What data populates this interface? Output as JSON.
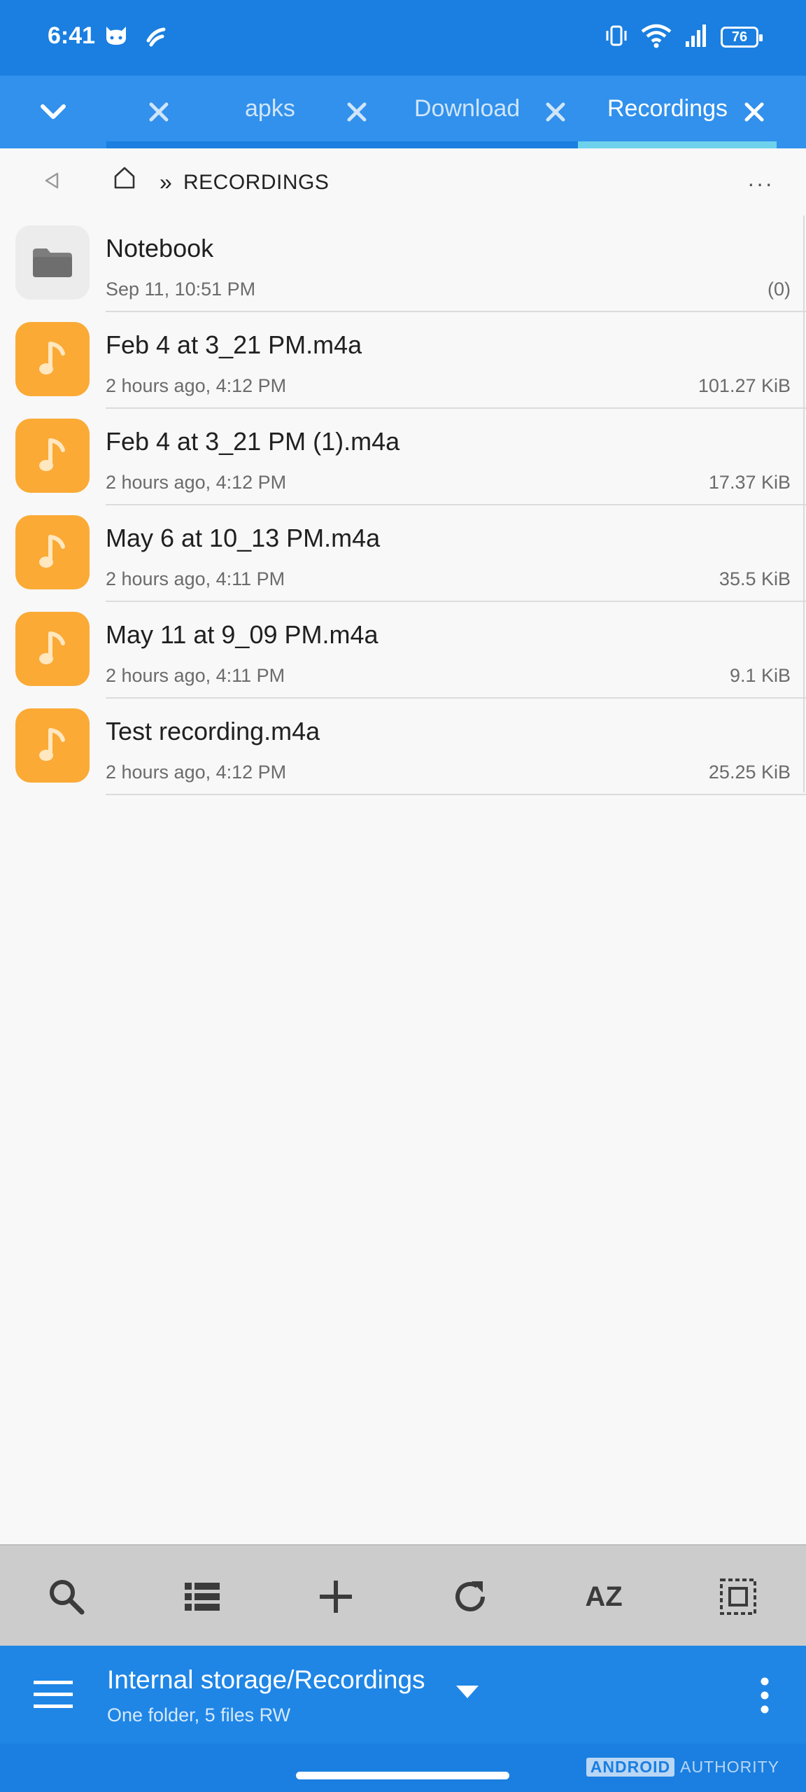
{
  "status_bar": {
    "time": "6:41",
    "battery": "76",
    "icons": [
      "cat-face-icon",
      "swipe-icon",
      "vibrate-icon",
      "wifi-icon",
      "signal-icon",
      "battery-icon"
    ]
  },
  "tabs": [
    {
      "label": "",
      "active": false
    },
    {
      "label": "apks",
      "active": false
    },
    {
      "label": "Download",
      "active": false
    },
    {
      "label": "Recordings",
      "active": true
    }
  ],
  "breadcrumb": {
    "separator": "»",
    "current": "RECORDINGS",
    "more": "···"
  },
  "files": [
    {
      "name": "Notebook",
      "meta": "Sep 11, 10:51 PM",
      "size": "(0)",
      "type": "folder"
    },
    {
      "name": "Feb 4 at 3_21 PM.m4a",
      "meta": "2 hours ago, 4:12 PM",
      "size": "101.27 KiB",
      "type": "audio"
    },
    {
      "name": "Feb 4 at 3_21 PM (1).m4a",
      "meta": "2 hours ago, 4:12 PM",
      "size": "17.37 KiB",
      "type": "audio"
    },
    {
      "name": "May 6 at 10_13 PM.m4a",
      "meta": "2 hours ago, 4:11 PM",
      "size": "35.5 KiB",
      "type": "audio"
    },
    {
      "name": "May 11 at 9_09 PM.m4a",
      "meta": "2 hours ago, 4:11 PM",
      "size": "9.1 KiB",
      "type": "audio"
    },
    {
      "name": "Test recording.m4a",
      "meta": "2 hours ago, 4:12 PM",
      "size": "25.25 KiB",
      "type": "audio"
    }
  ],
  "toolbar": {
    "sort_label": "AZ",
    "icons": [
      "search-icon",
      "list-view-icon",
      "add-icon",
      "refresh-icon",
      "sort-icon",
      "select-all-icon"
    ]
  },
  "footer": {
    "path": "Internal storage/Recordings",
    "summary": "One folder, 5 files RW"
  },
  "watermark": {
    "brand_box": "ANDROID",
    "brand_text": "AUTHORITY"
  },
  "colors": {
    "status_bar": "#1a7fe0",
    "tab_bar": "#3191ec",
    "tab_indicator_active": "#6fd2ec",
    "tab_indicator": "#1a7fe0",
    "audio_icon": "#fbaa36",
    "footer": "#1f86e6",
    "toolbar": "#cccccc"
  }
}
